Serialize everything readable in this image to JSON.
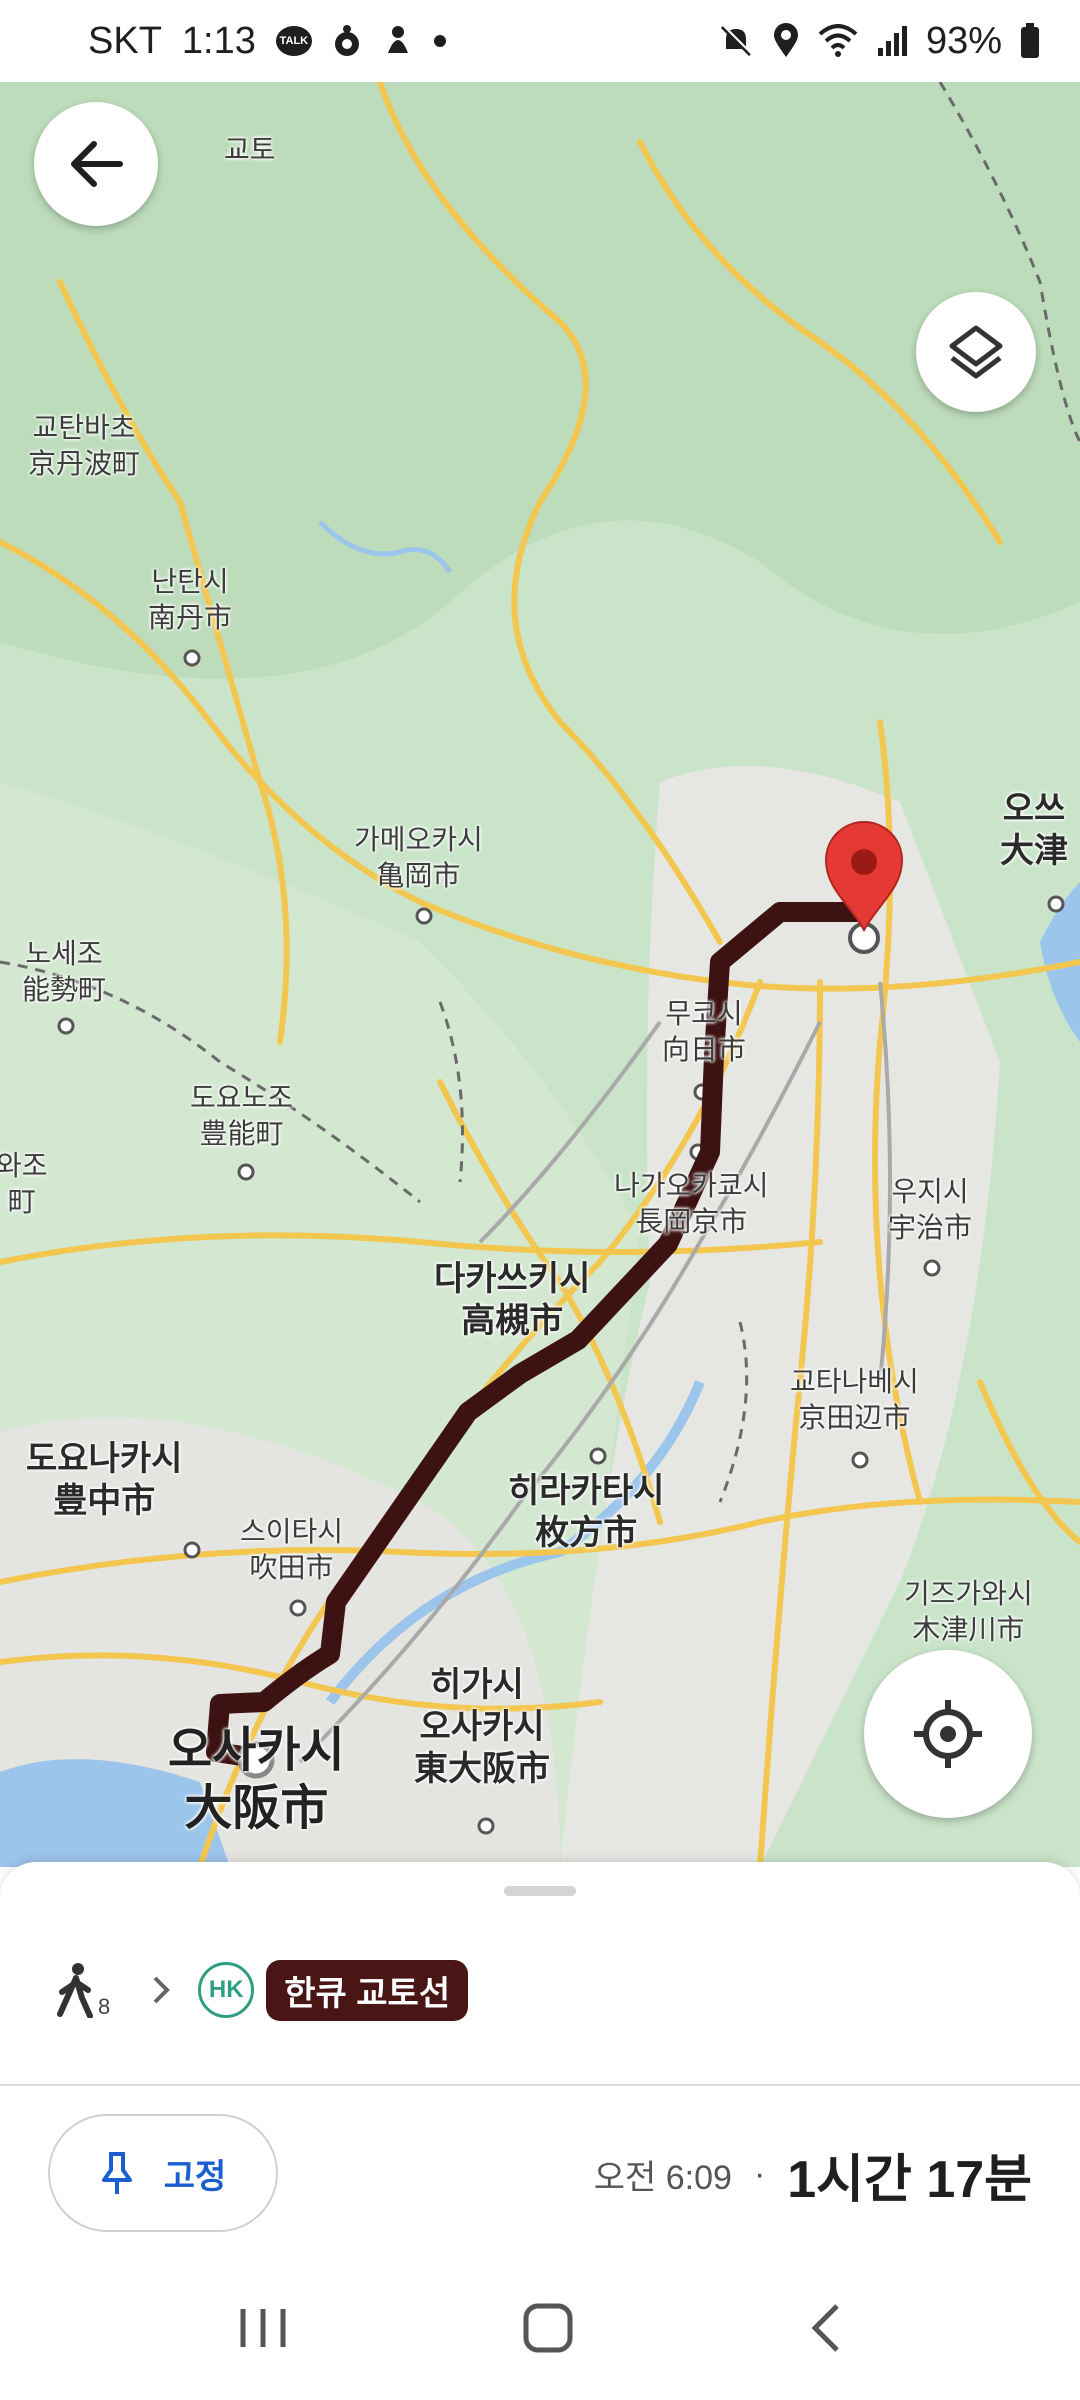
{
  "status_bar": {
    "carrier": "SKT",
    "time": "1:13",
    "talk_icon_text": "TALK",
    "battery": "93%",
    "icons": [
      "talk-icon",
      "mascot-icon",
      "notification-icon",
      "dot-icon",
      "mute-icon",
      "location-icon",
      "wifi-icon",
      "signal-icon",
      "battery-icon"
    ]
  },
  "map": {
    "places": [
      {
        "kr": "교토",
        "jp": ""
      },
      {
        "kr": "교탄바초",
        "jp": "京丹波町"
      },
      {
        "kr": "난탄시",
        "jp": "南丹市"
      },
      {
        "kr": "가메오카시",
        "jp": "亀岡市"
      },
      {
        "kr": "노세조",
        "jp": "能勢町"
      },
      {
        "kr": "도요노조",
        "jp": "豊能町"
      },
      {
        "kr": "와조",
        "jp": "町"
      },
      {
        "kr": "오쓰",
        "jp": "大津"
      },
      {
        "kr": "무코시",
        "jp": "向日市"
      },
      {
        "kr": "나가오카쿄시",
        "jp": "長岡京市"
      },
      {
        "kr": "우지시",
        "jp": "宇治市"
      },
      {
        "kr": "다카쓰키시",
        "jp": "高槻市"
      },
      {
        "kr": "교타나베시",
        "jp": "京田辺市"
      },
      {
        "kr": "도요나카시",
        "jp": "豊中市"
      },
      {
        "kr": "스이타시",
        "jp": "吹田市"
      },
      {
        "kr": "히라카타시",
        "jp": "枚方市"
      },
      {
        "kr": "기즈가와시",
        "jp": "木津川市"
      },
      {
        "kr": "히가시",
        "jp": ""
      },
      {
        "kr": "오사카시",
        "jp": "東大阪市"
      },
      {
        "kr": "오사카시",
        "jp": "大阪市"
      }
    ],
    "route_color": "#3d1212",
    "destination_pin_color": "#e53935"
  },
  "route": {
    "walk_minutes": "8",
    "line_badge": "HK",
    "line_badge_color": "#2e9e82",
    "line_name": "한큐 교토선",
    "line_color": "#4a1515"
  },
  "actions": {
    "pin_label": "고정"
  },
  "trip": {
    "departure": "오전 6:09",
    "separator": "·",
    "duration": "1시간 17분"
  }
}
